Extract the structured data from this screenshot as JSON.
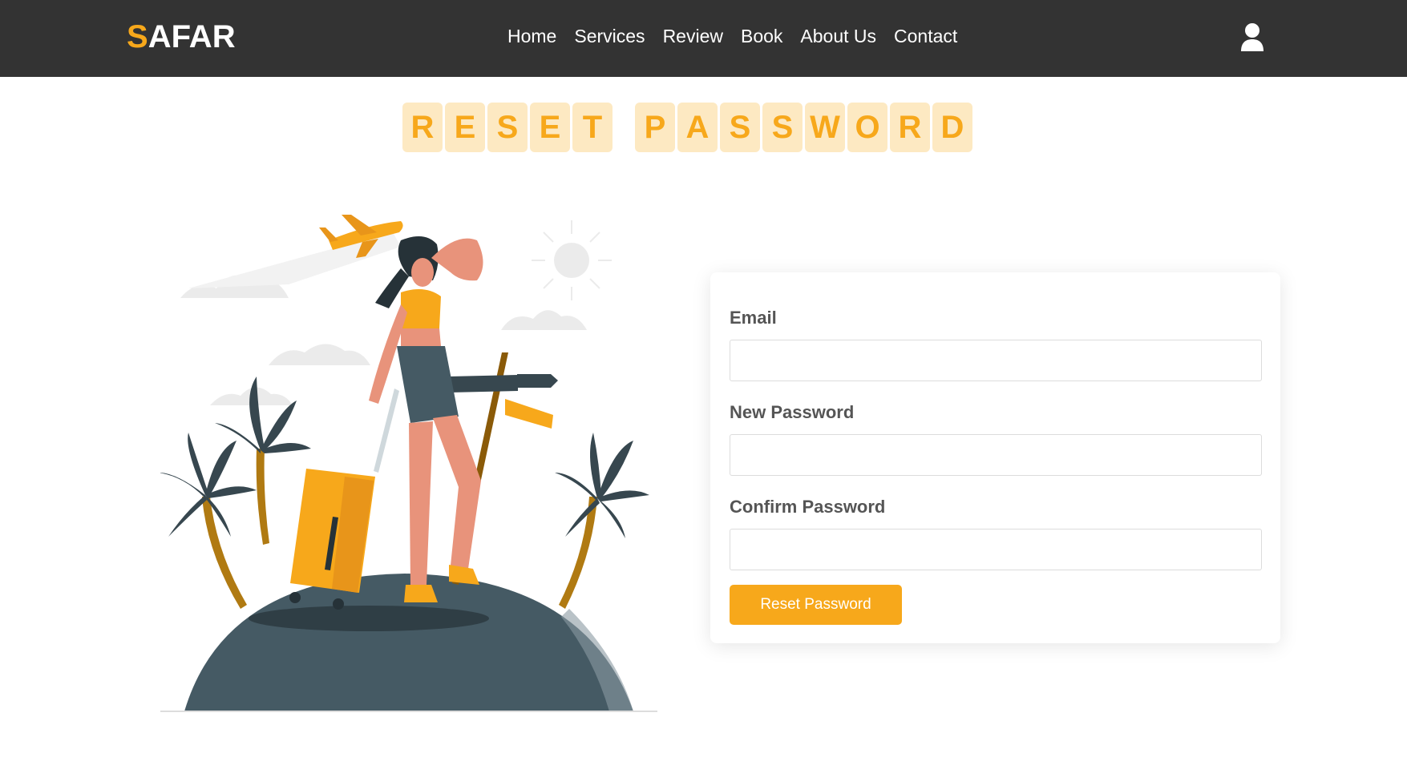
{
  "header": {
    "logo_first": "S",
    "logo_rest": "AFAR",
    "nav": [
      {
        "label": "Home"
      },
      {
        "label": "Services"
      },
      {
        "label": "Review"
      },
      {
        "label": "Book"
      },
      {
        "label": "About Us"
      },
      {
        "label": "Contact"
      }
    ],
    "user_icon": "user-icon"
  },
  "title": {
    "word1": [
      "R",
      "E",
      "S",
      "E",
      "T"
    ],
    "word2": [
      "P",
      "A",
      "S",
      "S",
      "W",
      "O",
      "R",
      "D"
    ]
  },
  "illustration": {
    "icon": "traveler-illustration"
  },
  "form": {
    "email_label": "Email",
    "email_value": "",
    "new_password_label": "New Password",
    "new_password_value": "",
    "confirm_password_label": "Confirm Password",
    "confirm_password_value": "",
    "submit_label": "Reset Password"
  },
  "colors": {
    "accent": "#f7a81b",
    "header_bg": "#333333",
    "tile_bg": "#fde9c2"
  }
}
